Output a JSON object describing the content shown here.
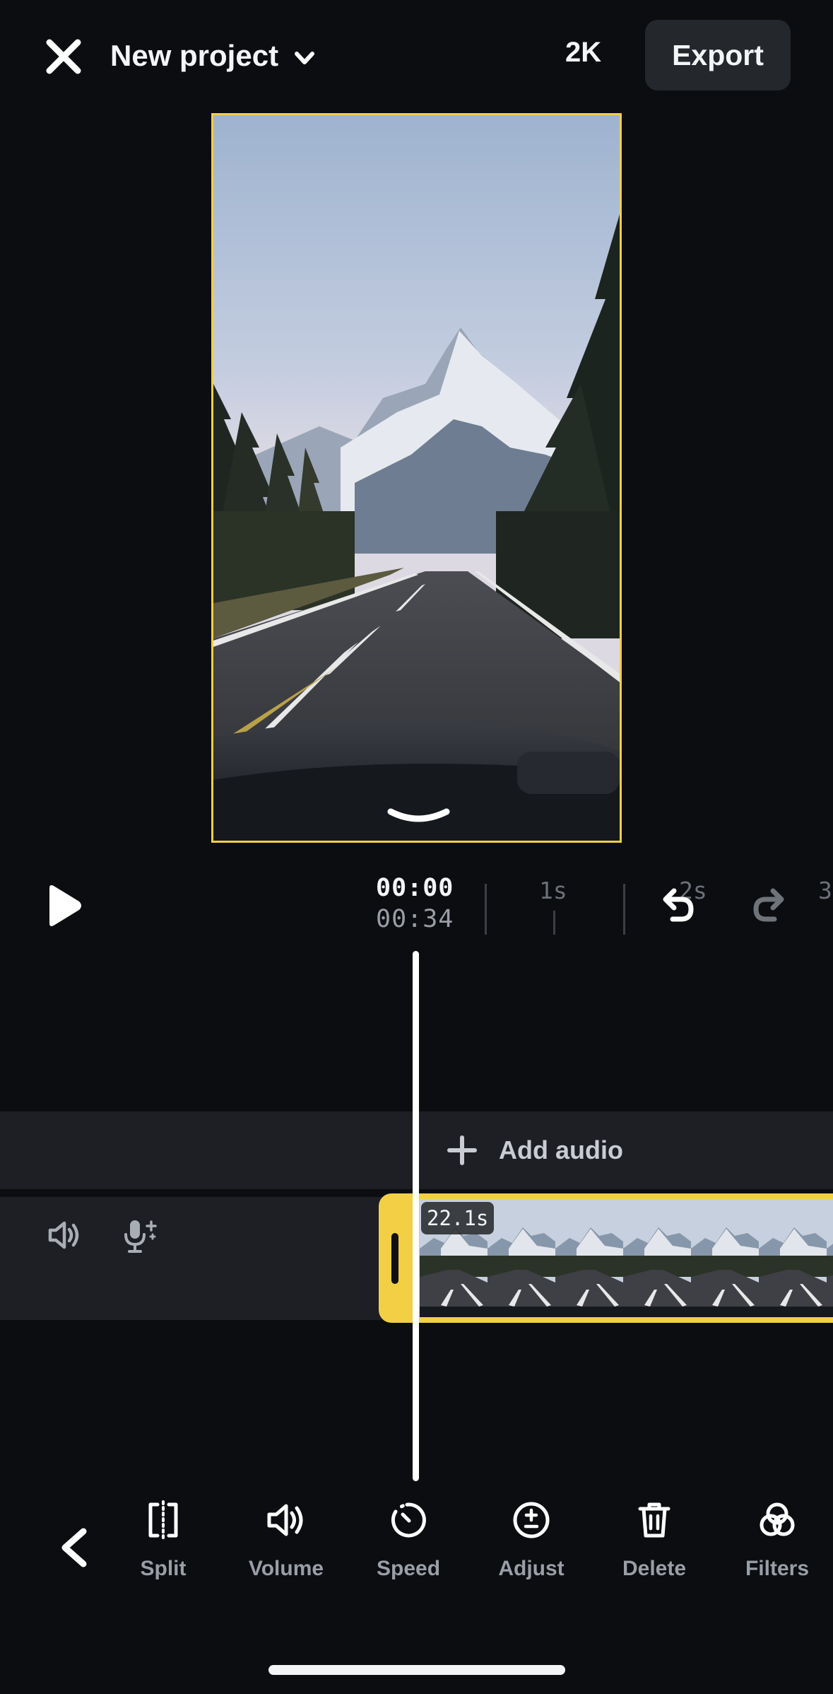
{
  "header": {
    "title": "New project",
    "resolution": "2K",
    "export_label": "Export",
    "close_icon": "close-icon",
    "title_dropdown_icon": "chevron-down-icon"
  },
  "preview": {
    "description_icon": "collapse-chevron-icon",
    "border_color": "#f2cf45"
  },
  "playback": {
    "current_time": "00:00",
    "total_time": "00:34",
    "ruler_labels": [
      "1s",
      "2s",
      "3"
    ]
  },
  "timeline": {
    "add_audio_label": "Add audio",
    "clip_duration": "22.1s",
    "clip_color": "#f2cf45"
  },
  "toolbar": {
    "items": [
      {
        "label": "Split",
        "icon": "split-icon"
      },
      {
        "label": "Volume",
        "icon": "volume-icon"
      },
      {
        "label": "Speed",
        "icon": "speed-icon"
      },
      {
        "label": "Adjust",
        "icon": "adjust-icon"
      },
      {
        "label": "Delete",
        "icon": "trash-icon"
      },
      {
        "label": "Filters",
        "icon": "filters-icon"
      }
    ]
  },
  "colors": {
    "background": "#0b0d10",
    "accent": "#f2cf45",
    "panel": "#1d1f24"
  }
}
